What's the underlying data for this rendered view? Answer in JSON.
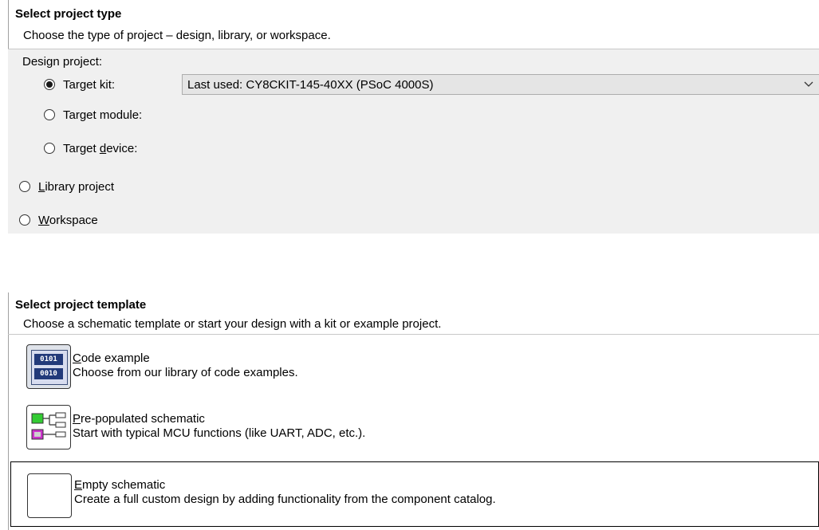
{
  "project_type": {
    "title": "Select project type",
    "subtitle": "Choose the type of project – design, library, or workspace.",
    "design_label": "Design project:",
    "options": [
      {
        "label_pre": "Target kit:",
        "label_u": "",
        "label_post": "",
        "checked": true
      },
      {
        "label_pre": "Target module:",
        "label_u": "",
        "label_post": "",
        "checked": false
      },
      {
        "label_pre": "Target ",
        "label_u": "d",
        "label_post": "evice:",
        "checked": false
      },
      {
        "label_pre": "",
        "label_u": "L",
        "label_post": "ibrary project",
        "checked": false
      },
      {
        "label_pre": "",
        "label_u": "W",
        "label_post": "orkspace",
        "checked": false
      }
    ],
    "kit_select_value": "Last used: CY8CKIT-145-40XX (PSoC 4000S)"
  },
  "project_template": {
    "title": "Select project template",
    "subtitle": "Choose a schematic template or start your design with a kit or example project.",
    "items": [
      {
        "title_u": "C",
        "title_rest": "ode example",
        "desc": "Choose from our library of code examples.",
        "icon": "code-binary-icon"
      },
      {
        "title_u": "P",
        "title_rest": "re-populated schematic",
        "desc": "Start with typical MCU functions (like UART, ADC, etc.).",
        "icon": "schematic-icon"
      },
      {
        "title_u": "E",
        "title_rest": "mpty schematic",
        "desc": "Create a full custom design by adding functionality from the component catalog.",
        "icon": "empty-schematic-icon",
        "selected": true
      }
    ],
    "icon_text_top": "0101",
    "icon_text_bottom": "0010"
  }
}
